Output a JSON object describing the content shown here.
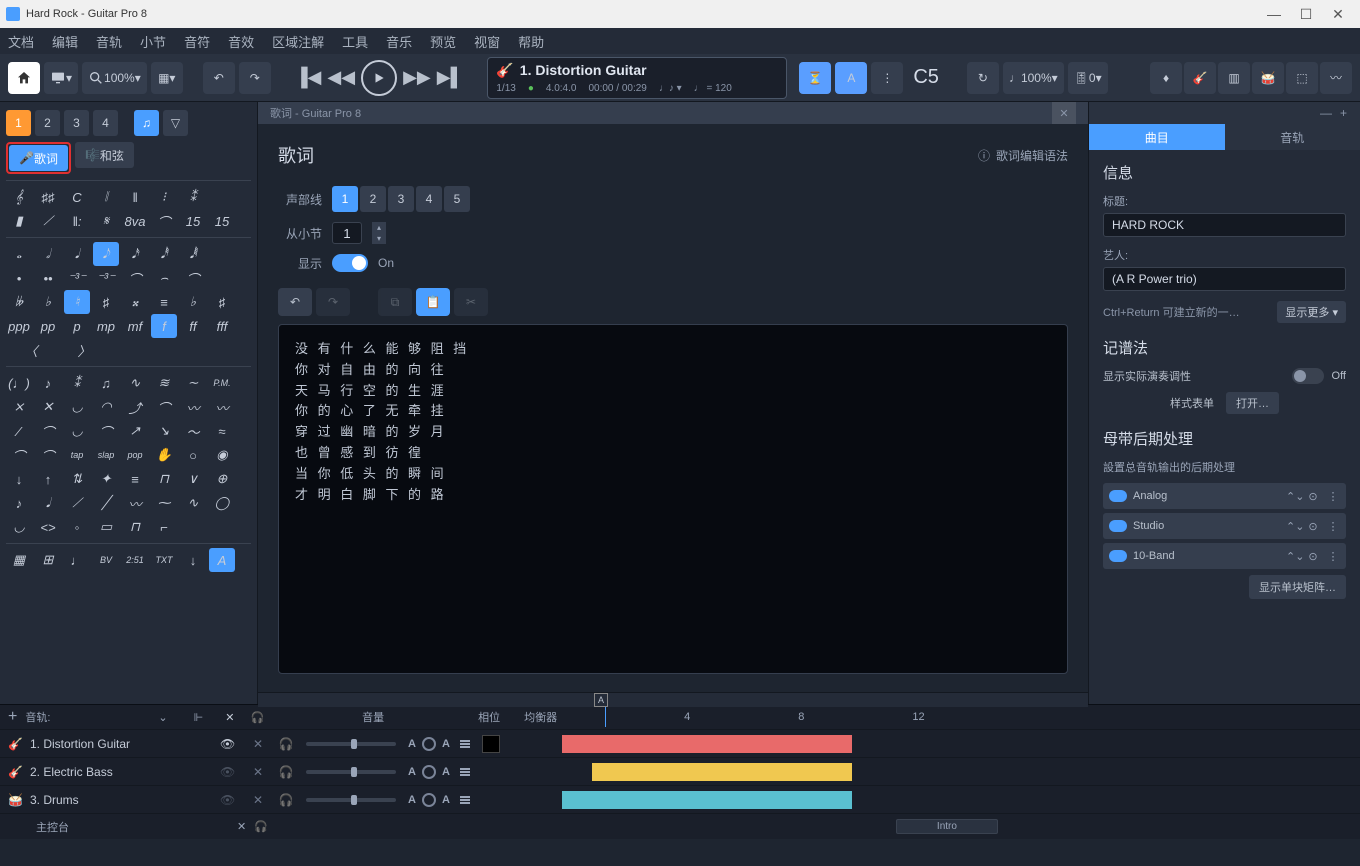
{
  "window": {
    "title": "Hard Rock - Guitar Pro 8"
  },
  "menus": [
    "文档",
    "编辑",
    "音轨",
    "小节",
    "音符",
    "音效",
    "区域注解",
    "工具",
    "音乐",
    "预览",
    "视窗",
    "帮助"
  ],
  "toolbar": {
    "zoom": "100%",
    "track_name": "1. Distortion Guitar",
    "bar_pos": "1/13",
    "time_sig": "4.0:4.0",
    "time": "00:00 / 00:29",
    "tempo": "= 120",
    "note_display": "C5",
    "strength": "100%",
    "pitch": "0"
  },
  "palette": {
    "voice_tabs": [
      "1",
      "2",
      "3",
      "4"
    ],
    "lyrics_btn": "歌词",
    "chords_btn": "和弦",
    "dyn_row": [
      "ppp",
      "pp",
      "p",
      "mp",
      "mf",
      "f",
      "ff",
      "fff"
    ],
    "txt_row": [
      "BV",
      "2:51",
      "TXT"
    ],
    "techniques": [
      "tap",
      "slap",
      "pop"
    ],
    "pm": "P.M."
  },
  "modal": {
    "title": "歌词 - Guitar Pro 8",
    "heading": "歌词",
    "help": "歌词编辑语法",
    "voice_label": "声部线",
    "voices": [
      "1",
      "2",
      "3",
      "4",
      "5"
    ],
    "from_bar_label": "从小节",
    "from_bar_val": "1",
    "show_label": "显示",
    "show_state": "On",
    "lines": [
      "没 有 什 么 能 够 阻 挡",
      "你 对 自 由 的 向 往",
      "天 马 行 空 的 生 涯",
      "你 的 心 了 无 牵 挂",
      "穿 过 幽 暗 的 岁 月",
      "也 曾 感 到 彷 徨",
      "当 你 低 头 的 瞬 间",
      "才 明 白 脚 下 的 路"
    ]
  },
  "inspector": {
    "tabs": [
      "曲目",
      "音轨"
    ],
    "info_h": "信息",
    "title_lbl": "标题:",
    "title_val": "HARD ROCK",
    "artist_lbl": "艺人:",
    "artist_val": "(A R Power trio)",
    "hint": "Ctrl+Return 可建立新的一…",
    "more": "显示更多 ▾",
    "notation_h": "记谱法",
    "real_play_lbl": "显示实际演奏调性",
    "real_play_state": "Off",
    "style_lbl": "样式表单",
    "style_btn": "打开…",
    "master_h": "母带后期处理",
    "master_sub": "設置总音轨输出的后期处理",
    "fx": [
      "Analog",
      "Studio",
      "10-Band"
    ],
    "single_btn": "显示单块矩阵…"
  },
  "trackhead": {
    "plus": "+",
    "tracks_lbl": "音轨:",
    "vol_lbl": "音量",
    "pan_lbl": "相位",
    "eq_lbl": "均衡器",
    "bars": [
      "4",
      "8",
      "12"
    ]
  },
  "tracks": [
    {
      "n": "1. Distortion Guitar",
      "color": "#e86a6a"
    },
    {
      "n": "2. Electric Bass",
      "color": "#f0c850"
    },
    {
      "n": "3. Drums",
      "color": "#5ac0d0"
    }
  ],
  "mixer": {
    "label": "主控台",
    "section": "Intro"
  }
}
